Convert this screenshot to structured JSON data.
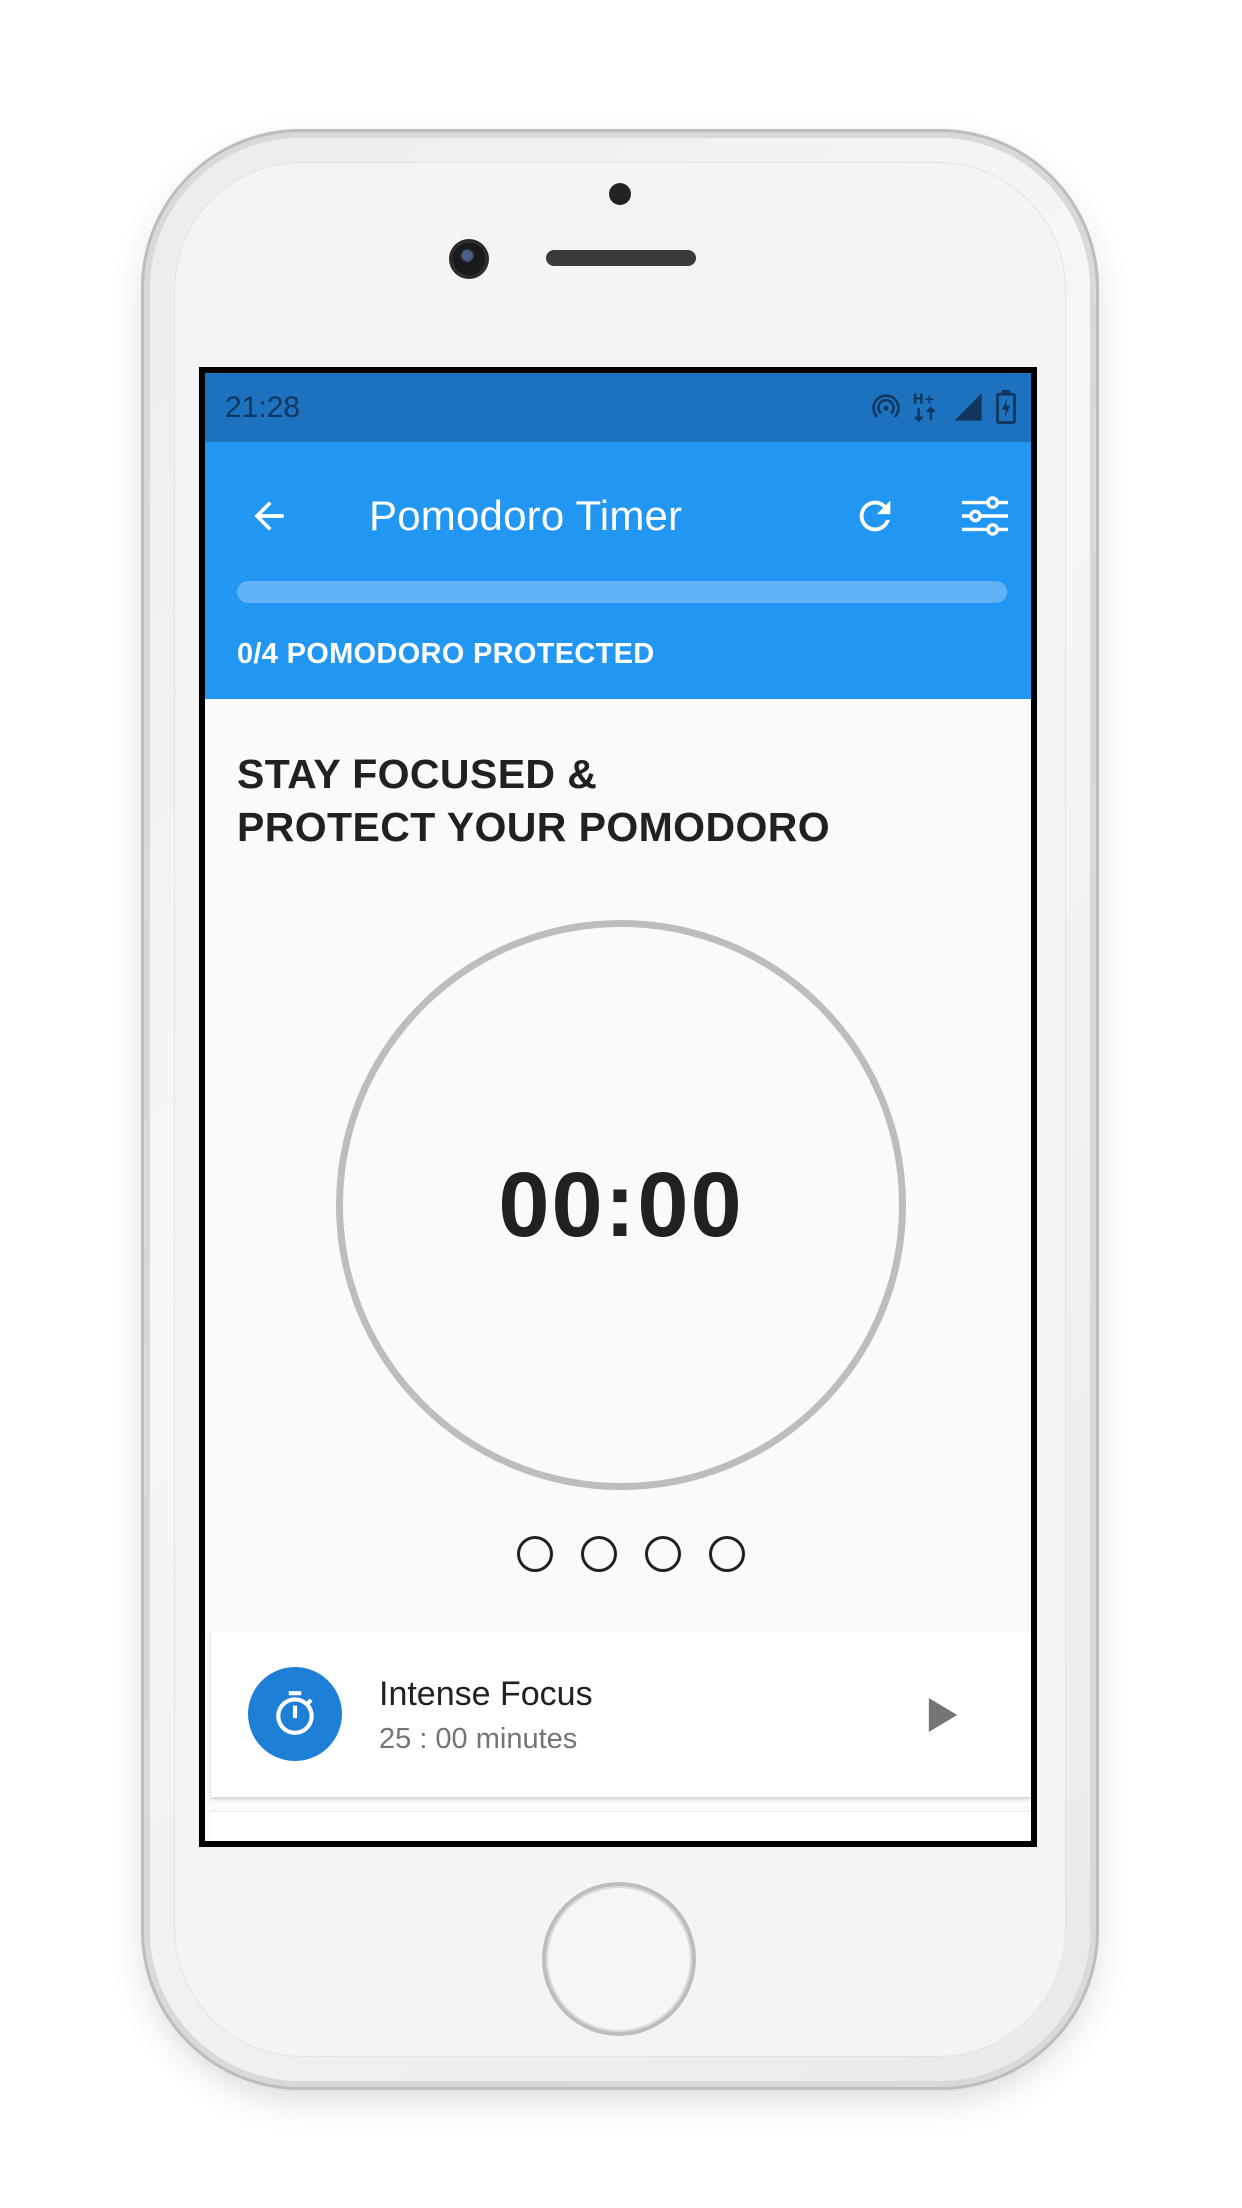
{
  "status_bar": {
    "time": "21:28",
    "icons": [
      "hotspot-icon",
      "network-h-plus-icon",
      "signal-icon",
      "battery-charging-icon"
    ]
  },
  "app_bar": {
    "title": "Pomodoro Timer",
    "back_icon": "arrow-back-icon",
    "refresh_icon": "refresh-icon",
    "settings_icon": "tune-sliders-icon",
    "progress_fraction": 0,
    "progress_label": "0/4 POMODORO PROTECTED"
  },
  "main": {
    "headline_line1": "STAY FOCUSED &",
    "headline_line2": "PROTECT YOUR POMODORO",
    "timer": "00:00",
    "pomodoro_dots": {
      "total": 4,
      "completed": 0
    }
  },
  "task": {
    "title": "Intense Focus",
    "subtitle": "25 : 00 minutes",
    "icon": "stopwatch-icon",
    "action_icon": "play-icon"
  },
  "colors": {
    "status_bar": "#1c72bf",
    "app_bar": "#2196f3",
    "progress_track": "#5fb2f6",
    "avatar": "#1e7fd6",
    "ring": "#bdbdbd",
    "background": "#fafafa"
  }
}
